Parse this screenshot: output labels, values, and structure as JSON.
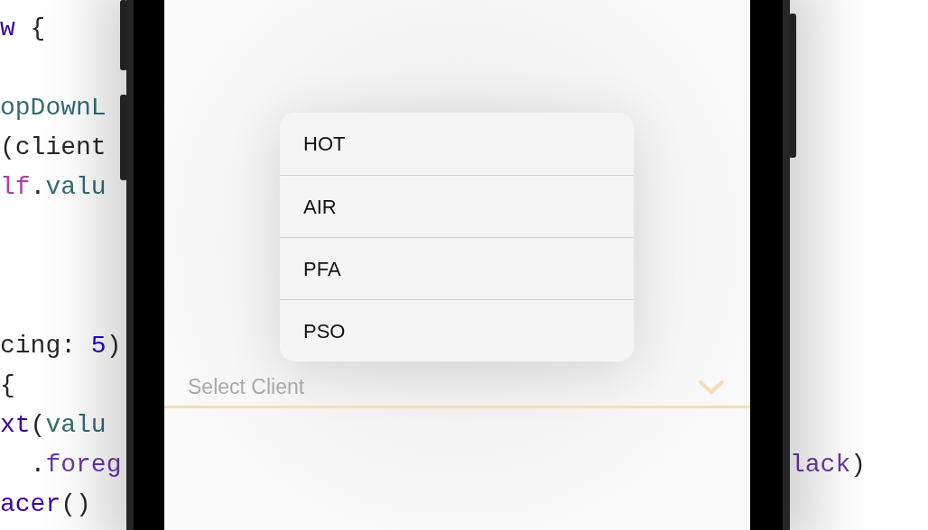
{
  "code_left": [
    {
      "lines": [
        {
          "tokens": [
            {
              "text": "w",
              "kind": "type"
            },
            {
              "text": " {",
              "kind": "plain"
            }
          ]
        }
      ]
    },
    {
      "lines": [
        {
          "tokens": [
            {
              "text": "opDownL",
              "kind": "project"
            }
          ]
        },
        {
          "tokens": [
            {
              "text": "(client",
              "kind": "plain"
            }
          ]
        },
        {
          "tokens": [
            {
              "text": "lf",
              "kind": "keyword"
            },
            {
              "text": ".",
              "kind": "plain"
            },
            {
              "text": "valu",
              "kind": "project"
            }
          ]
        }
      ]
    },
    {
      "lines": [
        {
          "tokens": [
            {
              "text": "cing: ",
              "kind": "plain"
            },
            {
              "text": "5",
              "kind": "number"
            },
            {
              "text": ")",
              "kind": "plain"
            }
          ]
        },
        {
          "tokens": [
            {
              "text": "{",
              "kind": "plain"
            }
          ]
        },
        {
          "tokens": [
            {
              "text": "xt",
              "kind": "type"
            },
            {
              "text": "(",
              "kind": "plain"
            },
            {
              "text": "valu",
              "kind": "project"
            }
          ]
        },
        {
          "tokens": [
            {
              "text": "  .",
              "kind": "plain"
            },
            {
              "text": "foreg",
              "kind": "system"
            }
          ]
        },
        {
          "tokens": [
            {
              "text": "acer",
              "kind": "type"
            },
            {
              "text": "()",
              "kind": "plain"
            }
          ]
        }
      ]
    }
  ],
  "code_right": [
    {
      "tokens": [
        {
          "text": "lack",
          "kind": "system"
        },
        {
          "text": ")",
          "kind": "plain"
        }
      ]
    }
  ],
  "dropdown": {
    "options": [
      {
        "label": "HOT"
      },
      {
        "label": "AIR"
      },
      {
        "label": "PFA"
      },
      {
        "label": "PSO"
      }
    ]
  },
  "select_field": {
    "placeholder": "Select Client"
  }
}
